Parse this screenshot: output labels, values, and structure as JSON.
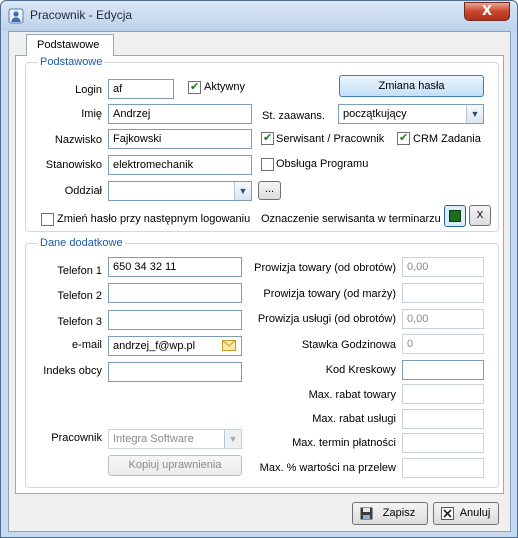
{
  "window": {
    "title": "Pracownik - Edycja",
    "close": "X"
  },
  "tabs": [
    {
      "label": "Podstawowe"
    }
  ],
  "basic": {
    "group_title": "Podstawowe",
    "login_label": "Login",
    "login_value": "af",
    "active_label": "Aktywny",
    "change_password_button": "Zmiana hasła",
    "first_name_label": "Imię",
    "first_name_value": "Andrzej",
    "level_label": "St. zaawans.",
    "level_value": "początkujący",
    "last_name_label": "Nazwisko",
    "last_name_value": "Fajkowski",
    "serviceman_label": "Serwisant / Pracownik",
    "crm_label": "CRM Zadania",
    "position_label": "Stanowisko",
    "position_value": "elektromechanik",
    "program_support_label": "Obsługa Programu",
    "branch_label": "Oddział",
    "branch_value": "",
    "browse_button": "...",
    "change_password_next_login_label": "Zmień hasło przy następnym logowaniu",
    "terminal_mark_label": "Oznaczenie serwisanta w terminarzu",
    "terminal_clear_button": "X",
    "terminal_color": "#1a6b1a"
  },
  "extra": {
    "group_title": "Dane dodatkowe",
    "phone1_label": "Telefon 1",
    "phone1_value": "650 34 32 11",
    "phone2_label": "Telefon 2",
    "phone2_value": "",
    "phone3_label": "Telefon 3",
    "phone3_value": "",
    "email_label": "e-mail",
    "email_value": "andrzej_f@wp.pl",
    "foreign_index_label": "Indeks obcy",
    "foreign_index_value": "",
    "employee_label": "Pracownik",
    "employee_value": "Integra Software",
    "copy_permissions_button": "Kopiuj uprawnienia",
    "comm_goods_turnover_label": "Prowizja towary (od obrotów)",
    "comm_goods_turnover_value": "0,00",
    "comm_goods_margin_label": "Prowizja towary (od marży)",
    "comm_goods_margin_value": "",
    "comm_services_label": "Prowizja usługi (od obrotów)",
    "comm_services_value": "0,00",
    "hourly_rate_label": "Stawka Godzinowa",
    "hourly_rate_value": "0",
    "barcode_label": "Kod Kreskowy",
    "barcode_value": "",
    "max_discount_goods_label": "Max. rabat towary",
    "max_discount_goods_value": "",
    "max_discount_services_label": "Max. rabat usługi",
    "max_discount_services_value": "",
    "max_payment_term_label": "Max. termin płatności",
    "max_payment_term_value": "",
    "max_transfer_percent_label": "Max. % wartości na przelew",
    "max_transfer_percent_value": ""
  },
  "footer": {
    "save_button": "Zapisz",
    "cancel_button": "Anuluj"
  }
}
